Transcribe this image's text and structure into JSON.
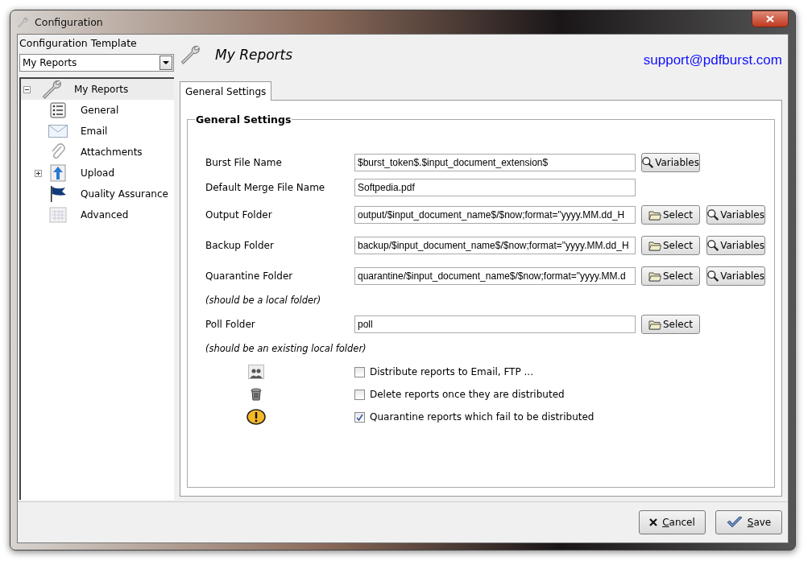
{
  "window": {
    "title": "Configuration"
  },
  "template": {
    "label": "Configuration Template",
    "value": "My Reports"
  },
  "tree": [
    {
      "label": "My Reports",
      "selected": true,
      "expanded": true,
      "children": [
        {
          "label": "General",
          "selected": false
        },
        {
          "label": "Email",
          "selected": false
        },
        {
          "label": "Attachments",
          "selected": false
        },
        {
          "label": "Upload",
          "selected": false,
          "expanded": false
        },
        {
          "label": "Quality Assurance",
          "selected": false
        },
        {
          "label": "Advanced",
          "selected": false
        }
      ]
    }
  ],
  "header": {
    "title": "My Reports",
    "email": "support@pdfburst.com"
  },
  "tabs": [
    {
      "label": "General Settings",
      "selected": true
    }
  ],
  "group": {
    "title": "General Settings"
  },
  "rows": [
    {
      "kind": "field",
      "label": "Burst File Name",
      "value": "$burst_token$.$input_document_extension$",
      "buttons": [
        {
          "kind": "variables",
          "label": "Variables"
        }
      ]
    },
    {
      "kind": "field",
      "label": "Default Merge File Name",
      "value": "Softpedia.pdf",
      "buttons": []
    },
    {
      "kind": "field",
      "label": "Output Folder",
      "value": "output/$input_document_name$/$now;format=\"yyyy.MM.dd_H",
      "buttons": [
        {
          "kind": "select",
          "label": "Select"
        },
        {
          "kind": "variables",
          "label": "Variables"
        }
      ]
    },
    {
      "kind": "field",
      "label": "Backup Folder",
      "value": "backup/$input_document_name$/$now;format=\"yyyy.MM.dd_H",
      "buttons": [
        {
          "kind": "select",
          "label": "Select"
        },
        {
          "kind": "variables",
          "label": "Variables"
        }
      ]
    },
    {
      "kind": "field",
      "label": "Quarantine Folder",
      "value": "quarantine/$input_document_name$/$now;format=\"yyyy.MM.d",
      "buttons": [
        {
          "kind": "select",
          "label": "Select"
        },
        {
          "kind": "variables",
          "label": "Variables"
        }
      ]
    },
    {
      "kind": "hint",
      "label": "(should be a local folder)"
    },
    {
      "kind": "field",
      "label": "Poll Folder",
      "value": "poll",
      "buttons": [
        {
          "kind": "select",
          "label": "Select"
        }
      ]
    },
    {
      "kind": "hint",
      "label": "(should be an existing local folder)"
    }
  ],
  "options": [
    {
      "label": "Distribute reports to Email, FTP ...",
      "checked": false
    },
    {
      "label": "Delete reports once they are distributed",
      "checked": false
    },
    {
      "label": "Quarantine reports which fail to be distributed",
      "checked": true
    }
  ],
  "footer": [
    {
      "kind": "cancel",
      "label": "Cancel"
    },
    {
      "kind": "save",
      "label": "Save"
    }
  ]
}
